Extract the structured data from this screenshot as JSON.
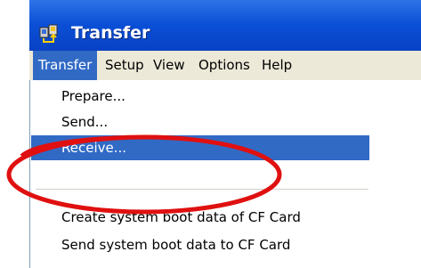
{
  "window": {
    "title": "Transfer",
    "icon": "transfer-app-icon"
  },
  "menubar": {
    "items": [
      {
        "label": "Transfer",
        "active": true
      },
      {
        "label": "Setup",
        "active": false
      },
      {
        "label": "View",
        "active": false
      },
      {
        "label": "Options",
        "active": false
      },
      {
        "label": "Help",
        "active": false
      }
    ]
  },
  "dropdown": {
    "items": [
      {
        "label": "Prepare..."
      },
      {
        "label": "Send..."
      },
      {
        "label": "Receive...",
        "highlighted": true
      },
      {
        "label": "Create system boot data of CF Card"
      },
      {
        "label": "Send system boot data to CF Card"
      }
    ]
  },
  "colors": {
    "titlebar": "#0a4fd6",
    "menu_highlight": "#316ac5",
    "annotation_circle": "#e01010"
  }
}
